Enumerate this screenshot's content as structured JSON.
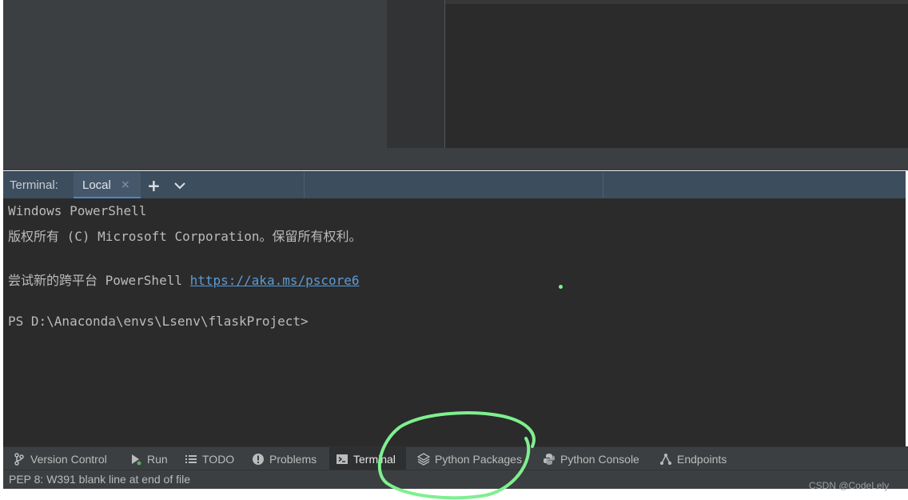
{
  "terminal": {
    "title": "Terminal:",
    "tab_label": "Local",
    "tab_close": "×",
    "new_tab": "+",
    "lines": {
      "l1": "Windows PowerShell",
      "l2": "版权所有 (C) Microsoft Corporation。保留所有权利。",
      "l3_prefix": "尝试新的跨平台 PowerShell ",
      "l3_link": "https://aka.ms/pscore6",
      "l4": "PS D:\\Anaconda\\envs\\Lsenv\\flaskProject>"
    }
  },
  "tool_windows": [
    {
      "label": "Version Control",
      "icon": "branch-icon"
    },
    {
      "label": "Run",
      "icon": "run-icon"
    },
    {
      "label": "TODO",
      "icon": "list-icon"
    },
    {
      "label": "Problems",
      "icon": "warning-circle-icon"
    },
    {
      "label": "Terminal",
      "icon": "terminal-icon",
      "active": true
    },
    {
      "label": "Python Packages",
      "icon": "layers-icon"
    },
    {
      "label": "Python Console",
      "icon": "python-icon"
    },
    {
      "label": "Endpoints",
      "icon": "endpoints-icon"
    }
  ],
  "status": {
    "message": "PEP 8: W391 blank line at end of file"
  },
  "watermark": "CSDN @CodeLely",
  "colors": {
    "accent": "#4a88c7",
    "link": "#5b9bd5",
    "annotation": "#7ef08f"
  }
}
